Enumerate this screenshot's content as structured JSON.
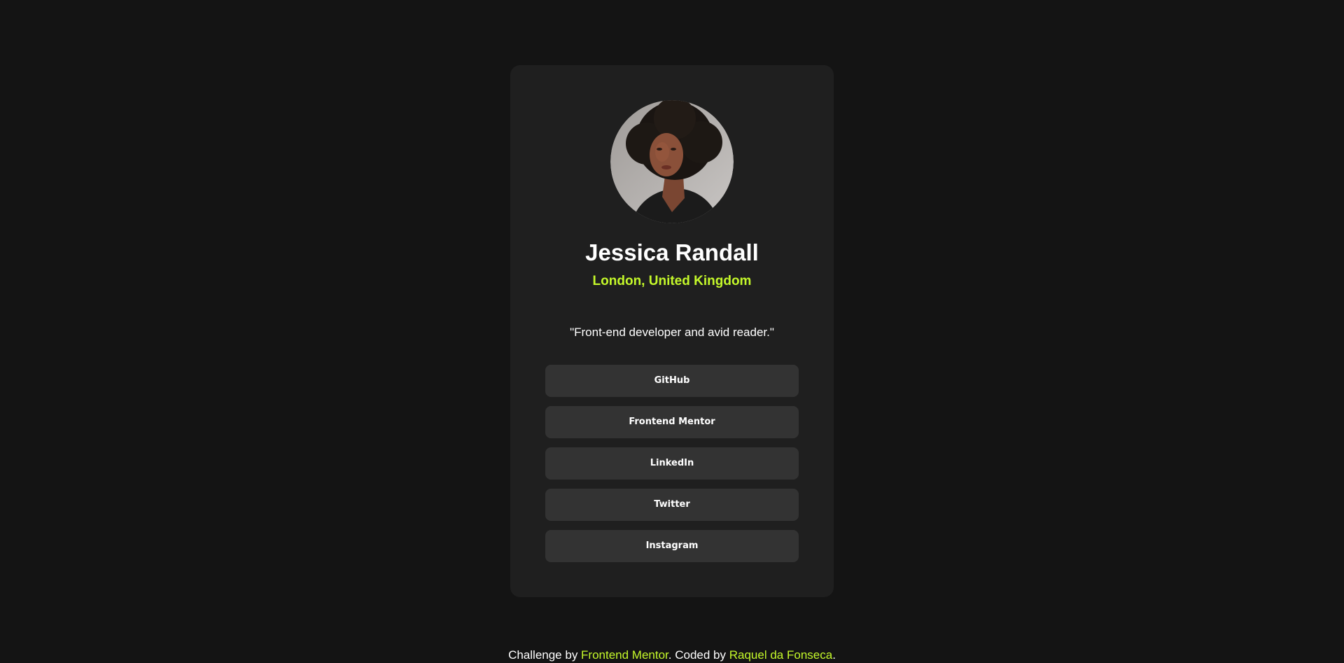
{
  "profile": {
    "name": "Jessica Randall",
    "location": "London, United Kingdom",
    "bio": "\"Front-end developer and avid reader.\""
  },
  "links": [
    {
      "label": "GitHub"
    },
    {
      "label": "Frontend Mentor"
    },
    {
      "label": "LinkedIn"
    },
    {
      "label": "Twitter"
    },
    {
      "label": "Instagram"
    }
  ],
  "footer": {
    "prefix": "Challenge by ",
    "challenge_link": "Frontend Mentor",
    "middle": ". Coded by ",
    "author_link": "Raquel da Fonseca",
    "suffix": "."
  },
  "colors": {
    "background": "#141414",
    "card": "#1f1f1f",
    "button": "#333333",
    "accent": "#c4f82a",
    "text": "#ffffff"
  }
}
